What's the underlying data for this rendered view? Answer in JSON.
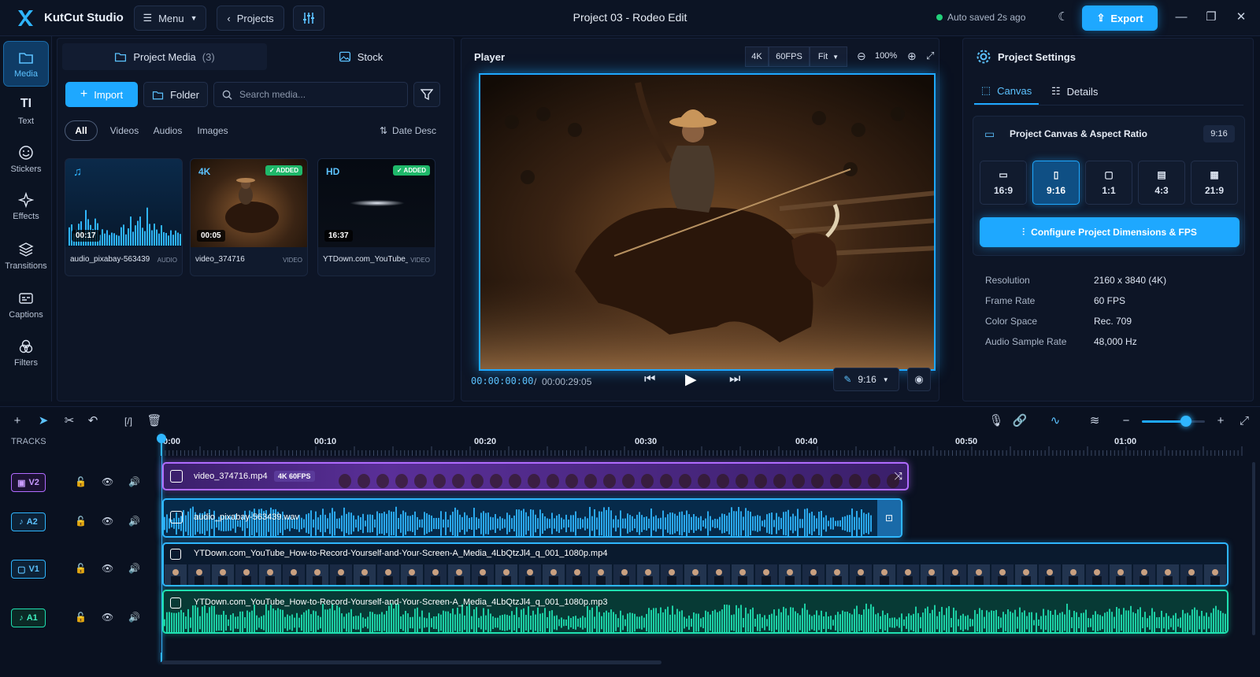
{
  "app": {
    "name": "KutCut Studio",
    "project_title": "Project 03 - Rodeo Edit",
    "autosave": "Auto saved 2s ago"
  },
  "toolbar": {
    "menu": "Menu",
    "projects": "Projects",
    "export": "Export"
  },
  "sidebar": {
    "items": [
      {
        "label": "Media",
        "icon": "folder-icon",
        "active": true
      },
      {
        "label": "Text",
        "icon": "text-icon"
      },
      {
        "label": "Stickers",
        "icon": "sticker-icon"
      },
      {
        "label": "Effects",
        "icon": "sparkle-icon"
      },
      {
        "label": "Transitions",
        "icon": "layers-icon"
      },
      {
        "label": "Captions",
        "icon": "captions-icon"
      },
      {
        "label": "Filters",
        "icon": "filters-icon"
      }
    ]
  },
  "media": {
    "tab_project": "Project Media",
    "count": "(3)",
    "tab_stock": "Stock",
    "import": "Import",
    "folder": "Folder",
    "search_placeholder": "Search media...",
    "filters": [
      "All",
      "Videos",
      "Audios",
      "Images"
    ],
    "sort": "Date Desc",
    "items": [
      {
        "name": "audio_pixabay-563439",
        "type": "AUDIO",
        "duration": "00:17",
        "quality": "",
        "added": ""
      },
      {
        "name": "video_374716",
        "type": "VIDEO",
        "duration": "00:05",
        "quality": "4K",
        "added": "ADDED"
      },
      {
        "name": "YTDown.com_YouTube_Ho...",
        "type": "VIDEO",
        "duration": "16:37",
        "quality": "HD",
        "added": "ADDED"
      }
    ]
  },
  "player": {
    "title": "Player",
    "res": "4K",
    "fps": "60FPS",
    "fit": "Fit",
    "zoom": "100%",
    "current_time": "00:00:00:00",
    "separator": "/",
    "total_time": "00:00:29:05",
    "aspect": "9:16"
  },
  "settings": {
    "title": "Project Settings",
    "tab_canvas": "Canvas",
    "tab_details": "Details",
    "canvas_title": "Project Canvas & Aspect Ratio",
    "canvas_badge": "9:16",
    "ratios": [
      {
        "label": "16:9",
        "icon": "monitor-icon"
      },
      {
        "label": "9:16",
        "icon": "phone-icon",
        "active": true
      },
      {
        "label": "1:1",
        "icon": "square-icon"
      },
      {
        "label": "4:3",
        "icon": "calendar-icon"
      },
      {
        "label": "21:9",
        "icon": "clapper-icon"
      }
    ],
    "configure": "Configure Project Dimensions & FPS",
    "info": [
      {
        "label": "Resolution",
        "value": "2160 x 3840 (4K)"
      },
      {
        "label": "Frame Rate",
        "value": "60 FPS"
      },
      {
        "label": "Color Space",
        "value": "Rec. 709"
      },
      {
        "label": "Audio Sample Rate",
        "value": "48,000 Hz"
      }
    ]
  },
  "timeline": {
    "tracks_label": "TRACKS",
    "ruler": [
      "0:00",
      "00:10",
      "00:20",
      "00:30",
      "00:40",
      "00:50",
      "01:00"
    ],
    "zoom_level": 0.7,
    "tracks": [
      {
        "id": "V2",
        "color": "#b06bff",
        "clip": "video_374716.mp4",
        "tag": "4K 60FPS"
      },
      {
        "id": "A2",
        "color": "#2fb6ff",
        "clip": "audio_pixabay-563439.wav"
      },
      {
        "id": "V1",
        "color": "#2fb6ff",
        "clip": "YTDown.com_YouTube_How-to-Record-Yourself-and-Your-Screen-A_Media_4LbQtzJl4_q_001_1080p.mp4"
      },
      {
        "id": "A1",
        "color": "#1fe0b0",
        "clip": "YTDown.com_YouTube_How-to-Record-Yourself-and-Your-Screen-A_Media_4LbQtzJl4_q_001_1080p.mp3"
      }
    ]
  },
  "colors": {
    "accent": "#1ea8ff",
    "purple": "#b06bff",
    "teal": "#1fe0b0",
    "bg": "#0a1120"
  }
}
